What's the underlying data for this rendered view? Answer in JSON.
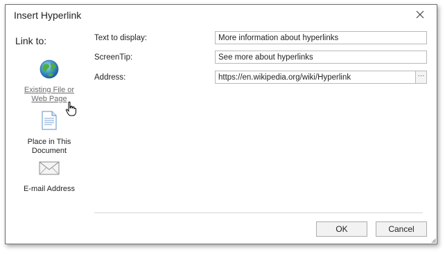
{
  "dialog": {
    "title": "Insert Hyperlink",
    "close_icon": "close-icon"
  },
  "sidebar": {
    "heading": "Link to:",
    "items": [
      {
        "label": "Existing File or Web Page",
        "icon": "globe-icon",
        "active": true
      },
      {
        "label": "Place in This Document",
        "icon": "document-icon",
        "active": false
      },
      {
        "label": "E-mail Address",
        "icon": "envelope-icon",
        "active": false
      }
    ]
  },
  "form": {
    "text_to_display_label": "Text to display:",
    "text_to_display_value": "More information about hyperlinks",
    "screentip_label": "ScreenTip:",
    "screentip_value": "See more about hyperlinks",
    "address_label": "Address:",
    "address_value": "https://en.wikipedia.org/wiki/Hyperlink",
    "browse_label": "···"
  },
  "buttons": {
    "ok_label": "OK",
    "cancel_label": "Cancel"
  },
  "colors": {
    "accent_hover_text": "#6b6b6b",
    "border": "#b8b8b8"
  }
}
